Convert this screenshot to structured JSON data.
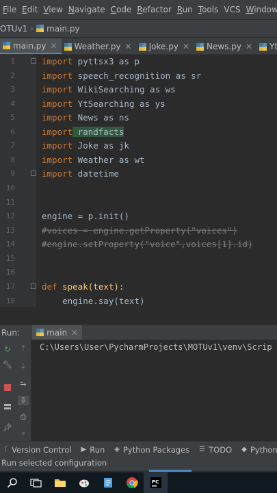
{
  "menu": {
    "items": [
      {
        "label": "File",
        "u": "F",
        "rest": "ile"
      },
      {
        "label": "Edit",
        "u": "E",
        "rest": "dit"
      },
      {
        "label": "View",
        "u": "V",
        "rest": "iew"
      },
      {
        "label": "Navigate",
        "u": "N",
        "rest": "avigate"
      },
      {
        "label": "Code",
        "u": "C",
        "rest": "ode"
      },
      {
        "label": "Refactor",
        "u": "R",
        "rest": "efactor"
      },
      {
        "label": "Run",
        "u": "R",
        "rest": "un"
      },
      {
        "label": "Tools",
        "u": "T",
        "rest": "ools"
      },
      {
        "label": "VCS",
        "u": "",
        "rest": "VCS"
      },
      {
        "label": "Window",
        "u": "W",
        "rest": "indow"
      }
    ]
  },
  "breadcrumb": {
    "project": "OTUv1",
    "file": "main.py"
  },
  "tabs": [
    {
      "label": "main.py",
      "active": true
    },
    {
      "label": "Weather.py",
      "active": false
    },
    {
      "label": "Joke.py",
      "active": false
    },
    {
      "label": "News.py",
      "active": false
    },
    {
      "label": "YtSe",
      "active": false
    }
  ],
  "editor": {
    "line_numbers": [
      "1",
      "2",
      "3",
      "4",
      "5",
      "6",
      "7",
      "8",
      "9",
      "10",
      "11",
      "12",
      "13",
      "14",
      "15",
      "16",
      "17",
      "18"
    ],
    "lines": [
      {
        "kw": "import",
        "rest": " pyttsx3 as p"
      },
      {
        "kw": "import",
        "rest": " speech_recognition as sr"
      },
      {
        "kw": "import",
        "rest": " WikiSearching as ws"
      },
      {
        "kw": "import",
        "rest": " YtSearching as ys"
      },
      {
        "kw": "import",
        "rest": " News as ns"
      },
      {
        "kw": "import",
        "rest": " randfacts"
      },
      {
        "kw": "import",
        "rest": " Joke as jk"
      },
      {
        "kw": "import",
        "rest": " Weather as wt"
      },
      {
        "kw": "import",
        "rest": " datetime"
      },
      {
        "kw": "",
        "rest": ""
      },
      {
        "kw": "",
        "rest": ""
      },
      {
        "kw": "",
        "rest": "engine = p.init()"
      },
      {
        "kw": "",
        "rest": "#voices = engine.getProperty(\"voices\")"
      },
      {
        "kw": "",
        "rest": "#engine.setProperty(\"voice\",voices[1].id)"
      },
      {
        "kw": "",
        "rest": ""
      },
      {
        "kw": "",
        "rest": ""
      },
      {
        "kw": "def",
        "rest": "speak(text):"
      },
      {
        "kw": "",
        "rest": "    engine.say(text)"
      }
    ]
  },
  "run_panel": {
    "title": "Run:",
    "config": "main",
    "console_text": "C:\\Users\\User\\PycharmProjects\\MOTUv1\\venv\\Scrip"
  },
  "statusbar": {
    "items": [
      {
        "label": "Version Control",
        "icon": "branch-icon"
      },
      {
        "label": "Run",
        "icon": "run-icon"
      },
      {
        "label": "Python Packages",
        "icon": "packages-icon"
      },
      {
        "label": "TODO",
        "icon": "todo-icon"
      },
      {
        "label": "Python",
        "icon": "python-console-icon"
      }
    ],
    "hint": "Run selected configuration"
  },
  "taskbar": {
    "icons": [
      "search-icon",
      "task-view-icon",
      "file-explorer-icon",
      "app-icon",
      "notes-icon",
      "chrome-icon",
      "pycharm-icon"
    ]
  },
  "colors": {
    "keyword": "#cc7832",
    "function": "#ffc66d",
    "comment": "#808080",
    "text": "#a9b7c6",
    "accent": "#4a88c7"
  }
}
